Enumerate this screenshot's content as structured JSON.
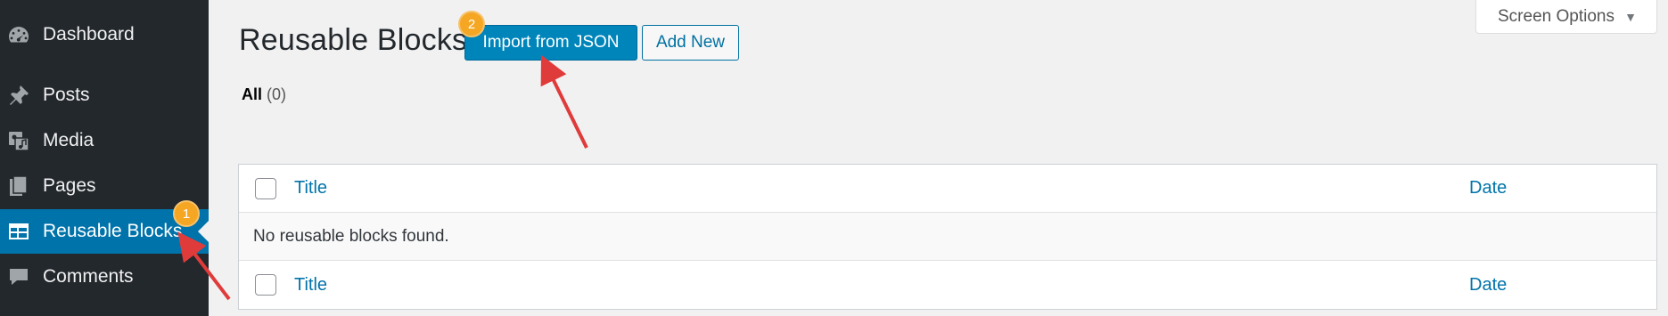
{
  "sidebar": {
    "items": [
      {
        "label": "Dashboard",
        "icon": "dashboard-icon"
      },
      {
        "label": "Posts",
        "icon": "pin-icon"
      },
      {
        "label": "Media",
        "icon": "media-icon"
      },
      {
        "label": "Pages",
        "icon": "pages-icon"
      },
      {
        "label": "Reusable Blocks",
        "icon": "table-icon",
        "active": true
      },
      {
        "label": "Comments",
        "icon": "comment-icon"
      }
    ]
  },
  "header": {
    "title": "Reusable Blocks",
    "import_label": "Import from JSON",
    "add_new_label": "Add New",
    "screen_options_label": "Screen Options"
  },
  "filters": {
    "all_label": "All",
    "all_count": "(0)"
  },
  "table": {
    "columns": {
      "title": "Title",
      "date": "Date"
    },
    "empty_message": "No reusable blocks found."
  },
  "annotations": {
    "badge_1": "1",
    "badge_2": "2",
    "badge_color": "#f5a623",
    "arrow_color": "#e03b3b"
  },
  "colors": {
    "sidebar_bg": "#23282d",
    "active_bg": "#0073aa",
    "primary_button": "#0085ba",
    "link": "#0073aa"
  }
}
